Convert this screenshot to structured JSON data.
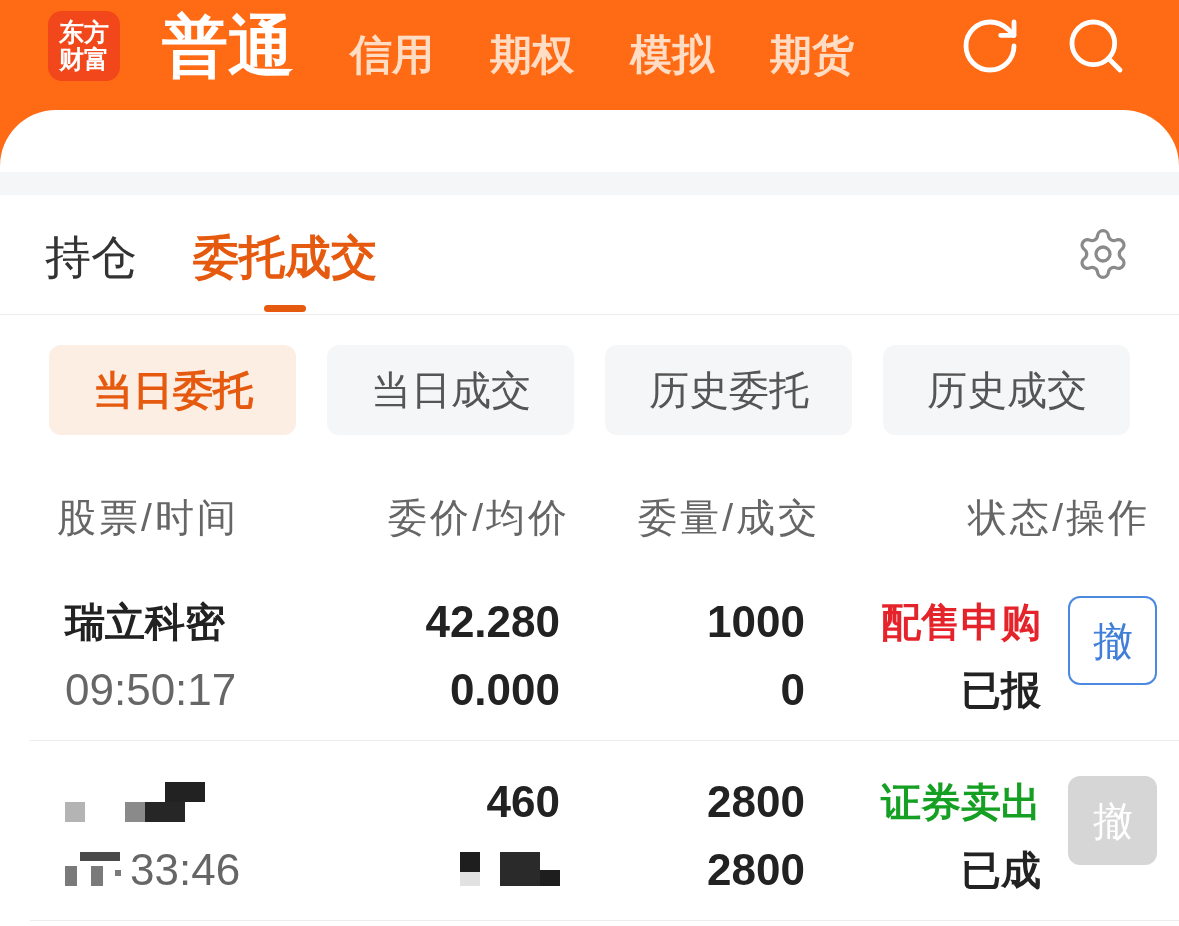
{
  "header": {
    "logo": {
      "lines": [
        "东方",
        "财富"
      ]
    },
    "account_tabs": [
      {
        "label": "普通",
        "selected": true
      },
      {
        "label": "信用",
        "selected": false
      },
      {
        "label": "期权",
        "selected": false
      },
      {
        "label": "模拟",
        "selected": false
      },
      {
        "label": "期货",
        "selected": false
      }
    ]
  },
  "tabs": [
    {
      "label": "持仓",
      "selected": false
    },
    {
      "label": "委托成交",
      "selected": true
    }
  ],
  "sub_tabs": [
    {
      "label": "当日委托",
      "selected": true
    },
    {
      "label": "当日成交",
      "selected": false
    },
    {
      "label": "历史委托",
      "selected": false
    },
    {
      "label": "历史成交",
      "selected": false
    }
  ],
  "table": {
    "columns": [
      "股票/时间",
      "委价/均价",
      "委量/成交",
      "状态/操作"
    ],
    "rows": [
      {
        "name": "瑞立科密",
        "time": "09:50:17",
        "price": "42.280",
        "avg_price": "0.000",
        "quantity": "1000",
        "filled": "0",
        "order_type": "配售申购",
        "color": "#e5232b",
        "status": "已报",
        "action": "撤",
        "disabled": false,
        "redacted": false
      },
      {
        "time": "33:46",
        "price": "460",
        "quantity": "2800",
        "filled": "2800",
        "order_type": "证券卖出",
        "color": "#16a023",
        "status": "已成",
        "action": "撤",
        "disabled": true,
        "redacted": true
      }
    ]
  }
}
